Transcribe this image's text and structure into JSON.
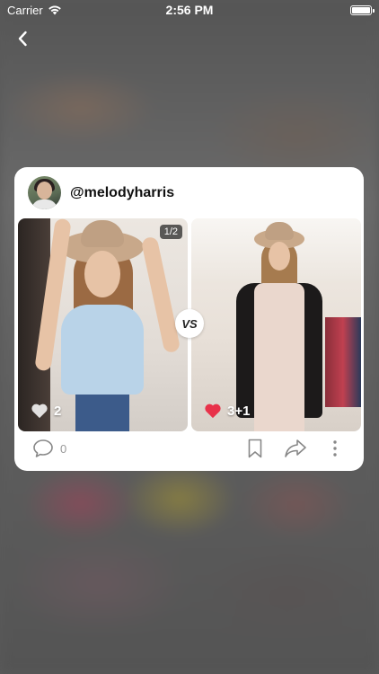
{
  "status_bar": {
    "carrier": "Carrier",
    "time": "2:56 PM"
  },
  "post": {
    "username": "@melodyharris",
    "photo_counter": "1/2",
    "vs_label": "VS",
    "left_likes": "2",
    "right_likes": "3+1",
    "comment_count": "0"
  },
  "icons": {
    "back": "chevron-left-icon",
    "comment": "speech-bubble-icon",
    "bookmark": "bookmark-icon",
    "share": "share-arrow-icon",
    "more": "more-vertical-icon",
    "like_left": "heart-outline-icon",
    "like_right": "heart-filled-icon"
  },
  "colors": {
    "heart_filled": "#e8324a",
    "text_primary": "#111111",
    "icon_gray": "#888888"
  }
}
